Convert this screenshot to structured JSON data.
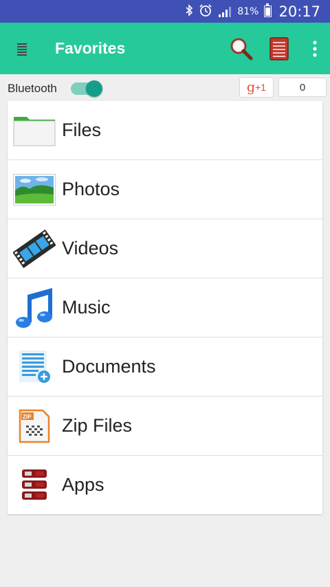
{
  "status_bar": {
    "battery": "81%",
    "battery_level": 0.81,
    "time": "20:17",
    "icons": [
      "bluetooth-icon",
      "alarm-icon",
      "signal-icon",
      "battery-icon"
    ]
  },
  "app_bar": {
    "title": "Favorites",
    "background": "#26c99a",
    "actions": [
      "search-icon",
      "book-icon",
      "more-vert-icon"
    ]
  },
  "quick_bar": {
    "bluetooth_label": "Bluetooth",
    "bluetooth_on": true,
    "gplus_label_g": "g",
    "gplus_label_plus": "+1",
    "gplus_count": "0"
  },
  "favorites": [
    {
      "label": "Files",
      "icon": "folder-icon"
    },
    {
      "label": "Photos",
      "icon": "photo-icon"
    },
    {
      "label": "Videos",
      "icon": "film-icon"
    },
    {
      "label": "Music",
      "icon": "music-note-icon"
    },
    {
      "label": "Documents",
      "icon": "document-icon"
    },
    {
      "label": "Zip Files",
      "icon": "zip-icon"
    },
    {
      "label": "Apps",
      "icon": "apps-icon"
    }
  ]
}
